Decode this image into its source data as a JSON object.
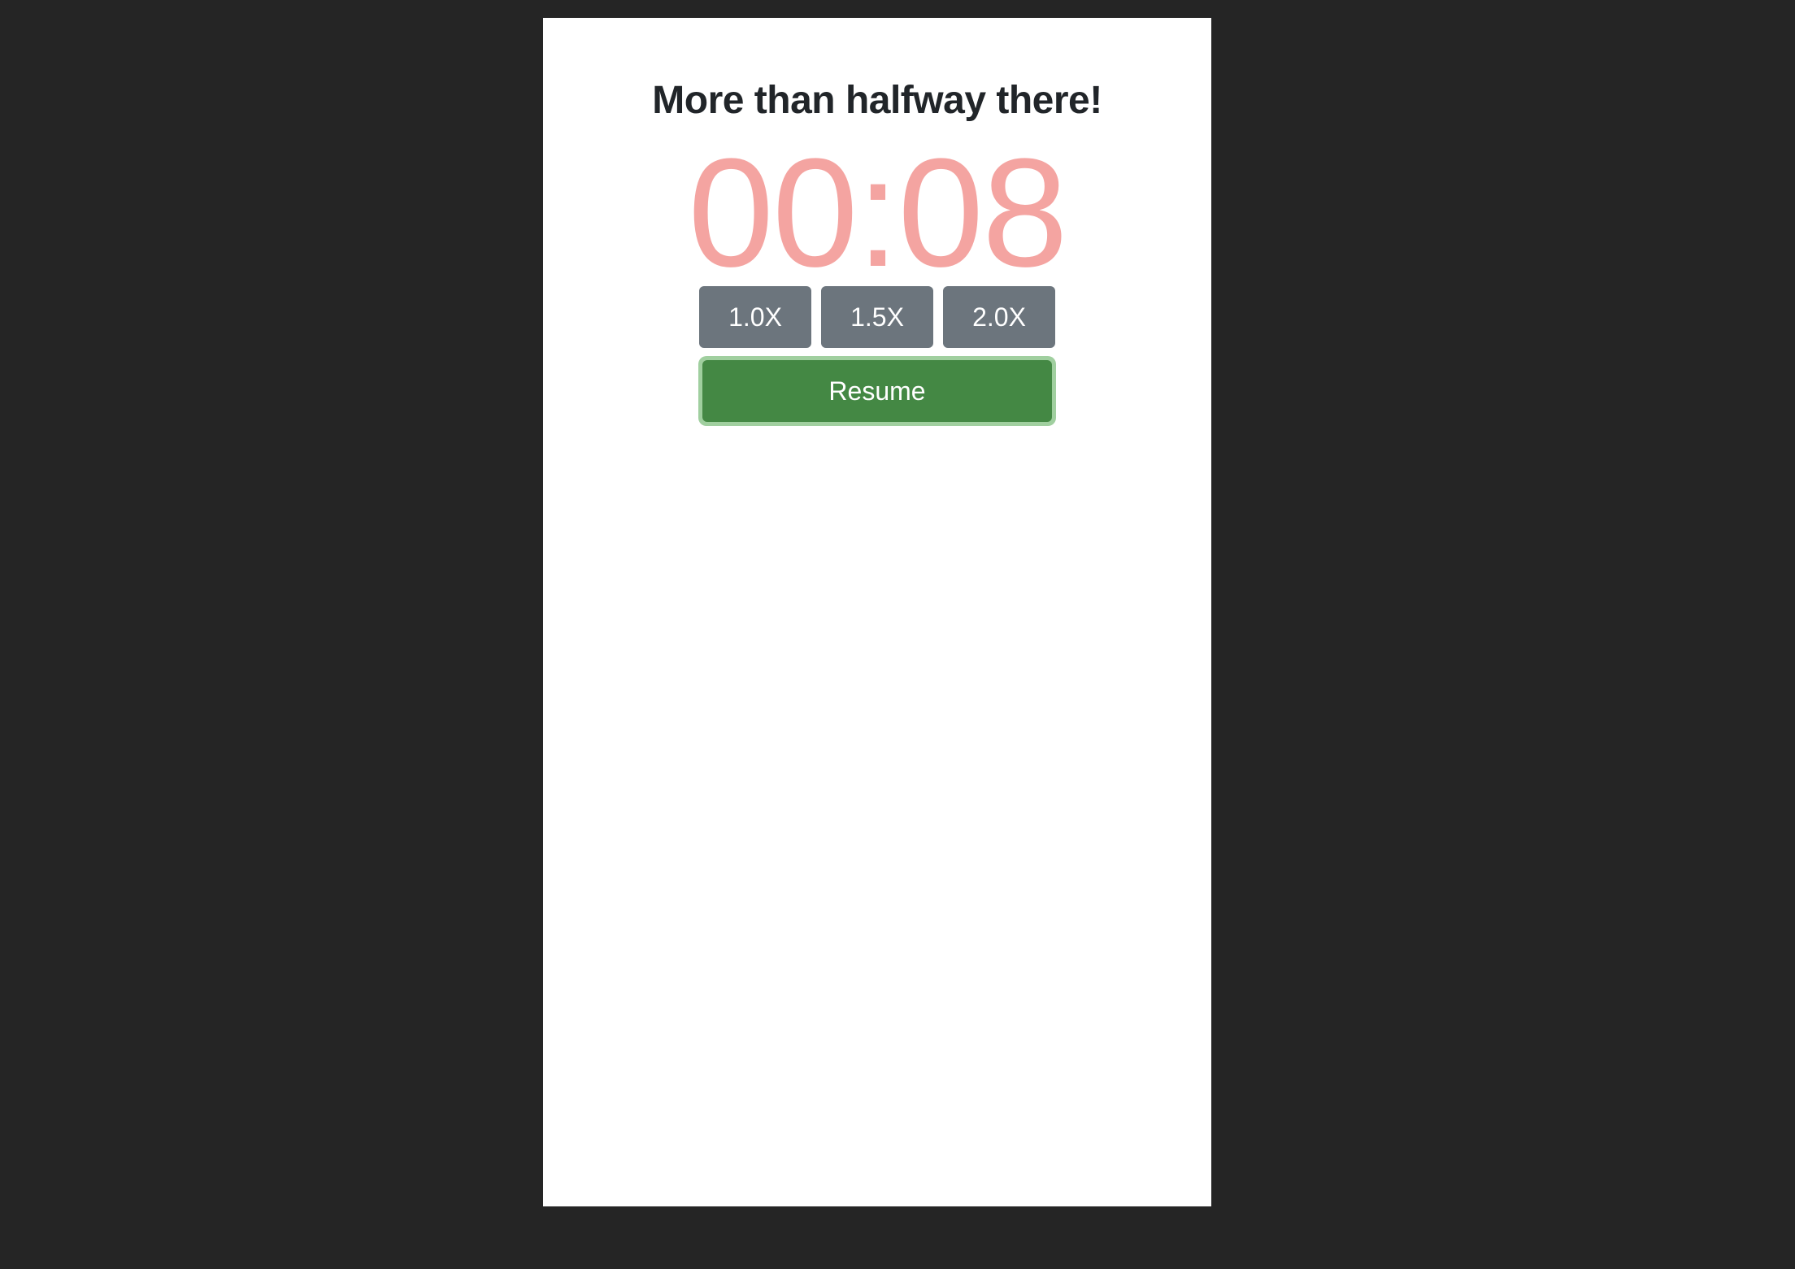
{
  "colors": {
    "page_background": "#252525",
    "card_background": "#ffffff",
    "message_text": "#212529",
    "timer_text": "#f4a4a1",
    "speed_button_bg": "#6c757d",
    "resume_button_bg": "#448844",
    "resume_focus_ring": "#a0cf9f"
  },
  "message": "More than halfway there!",
  "timer": {
    "display": "00:08"
  },
  "speed_buttons": [
    {
      "label": "1.0X"
    },
    {
      "label": "1.5X"
    },
    {
      "label": "2.0X"
    }
  ],
  "resume_button": {
    "label": "Resume"
  }
}
